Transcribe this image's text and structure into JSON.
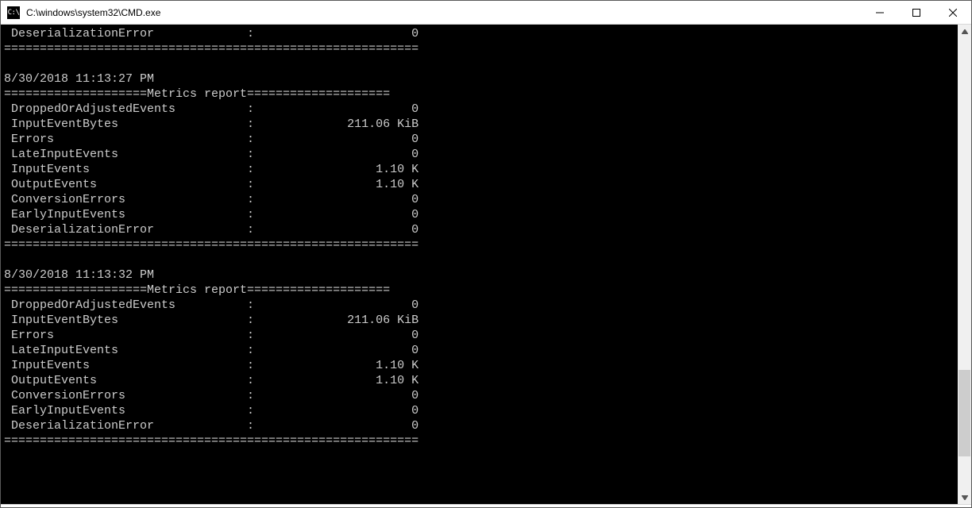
{
  "window": {
    "title": "C:\\windows\\system32\\CMD.exe",
    "icon_text": "C:\\"
  },
  "truncated_top": {
    "label": "DeserializationError",
    "value": "0"
  },
  "section_header": "Metrics report",
  "divider_full": "==========================================================",
  "divider_left": "====================",
  "divider_right": "====================",
  "reports": [
    {
      "timestamp": "8/30/2018 11:13:27 PM",
      "rows": [
        {
          "label": "DroppedOrAdjustedEvents",
          "value": "0"
        },
        {
          "label": "InputEventBytes",
          "value": "211.06 KiB"
        },
        {
          "label": "Errors",
          "value": "0"
        },
        {
          "label": "LateInputEvents",
          "value": "0"
        },
        {
          "label": "InputEvents",
          "value": "1.10 K"
        },
        {
          "label": "OutputEvents",
          "value": "1.10 K"
        },
        {
          "label": "ConversionErrors",
          "value": "0"
        },
        {
          "label": "EarlyInputEvents",
          "value": "0"
        },
        {
          "label": "DeserializationError",
          "value": "0"
        }
      ]
    },
    {
      "timestamp": "8/30/2018 11:13:32 PM",
      "rows": [
        {
          "label": "DroppedOrAdjustedEvents",
          "value": "0"
        },
        {
          "label": "InputEventBytes",
          "value": "211.06 KiB"
        },
        {
          "label": "Errors",
          "value": "0"
        },
        {
          "label": "LateInputEvents",
          "value": "0"
        },
        {
          "label": "InputEvents",
          "value": "1.10 K"
        },
        {
          "label": "OutputEvents",
          "value": "1.10 K"
        },
        {
          "label": "ConversionErrors",
          "value": "0"
        },
        {
          "label": "EarlyInputEvents",
          "value": "0"
        },
        {
          "label": "DeserializationError",
          "value": "0"
        }
      ]
    }
  ],
  "layout": {
    "label_col": 1,
    "label_width": 33,
    "value_end_col": 58
  },
  "scrollbar": {
    "thumb_top_pct": 72,
    "thumb_height_pct": 18
  }
}
